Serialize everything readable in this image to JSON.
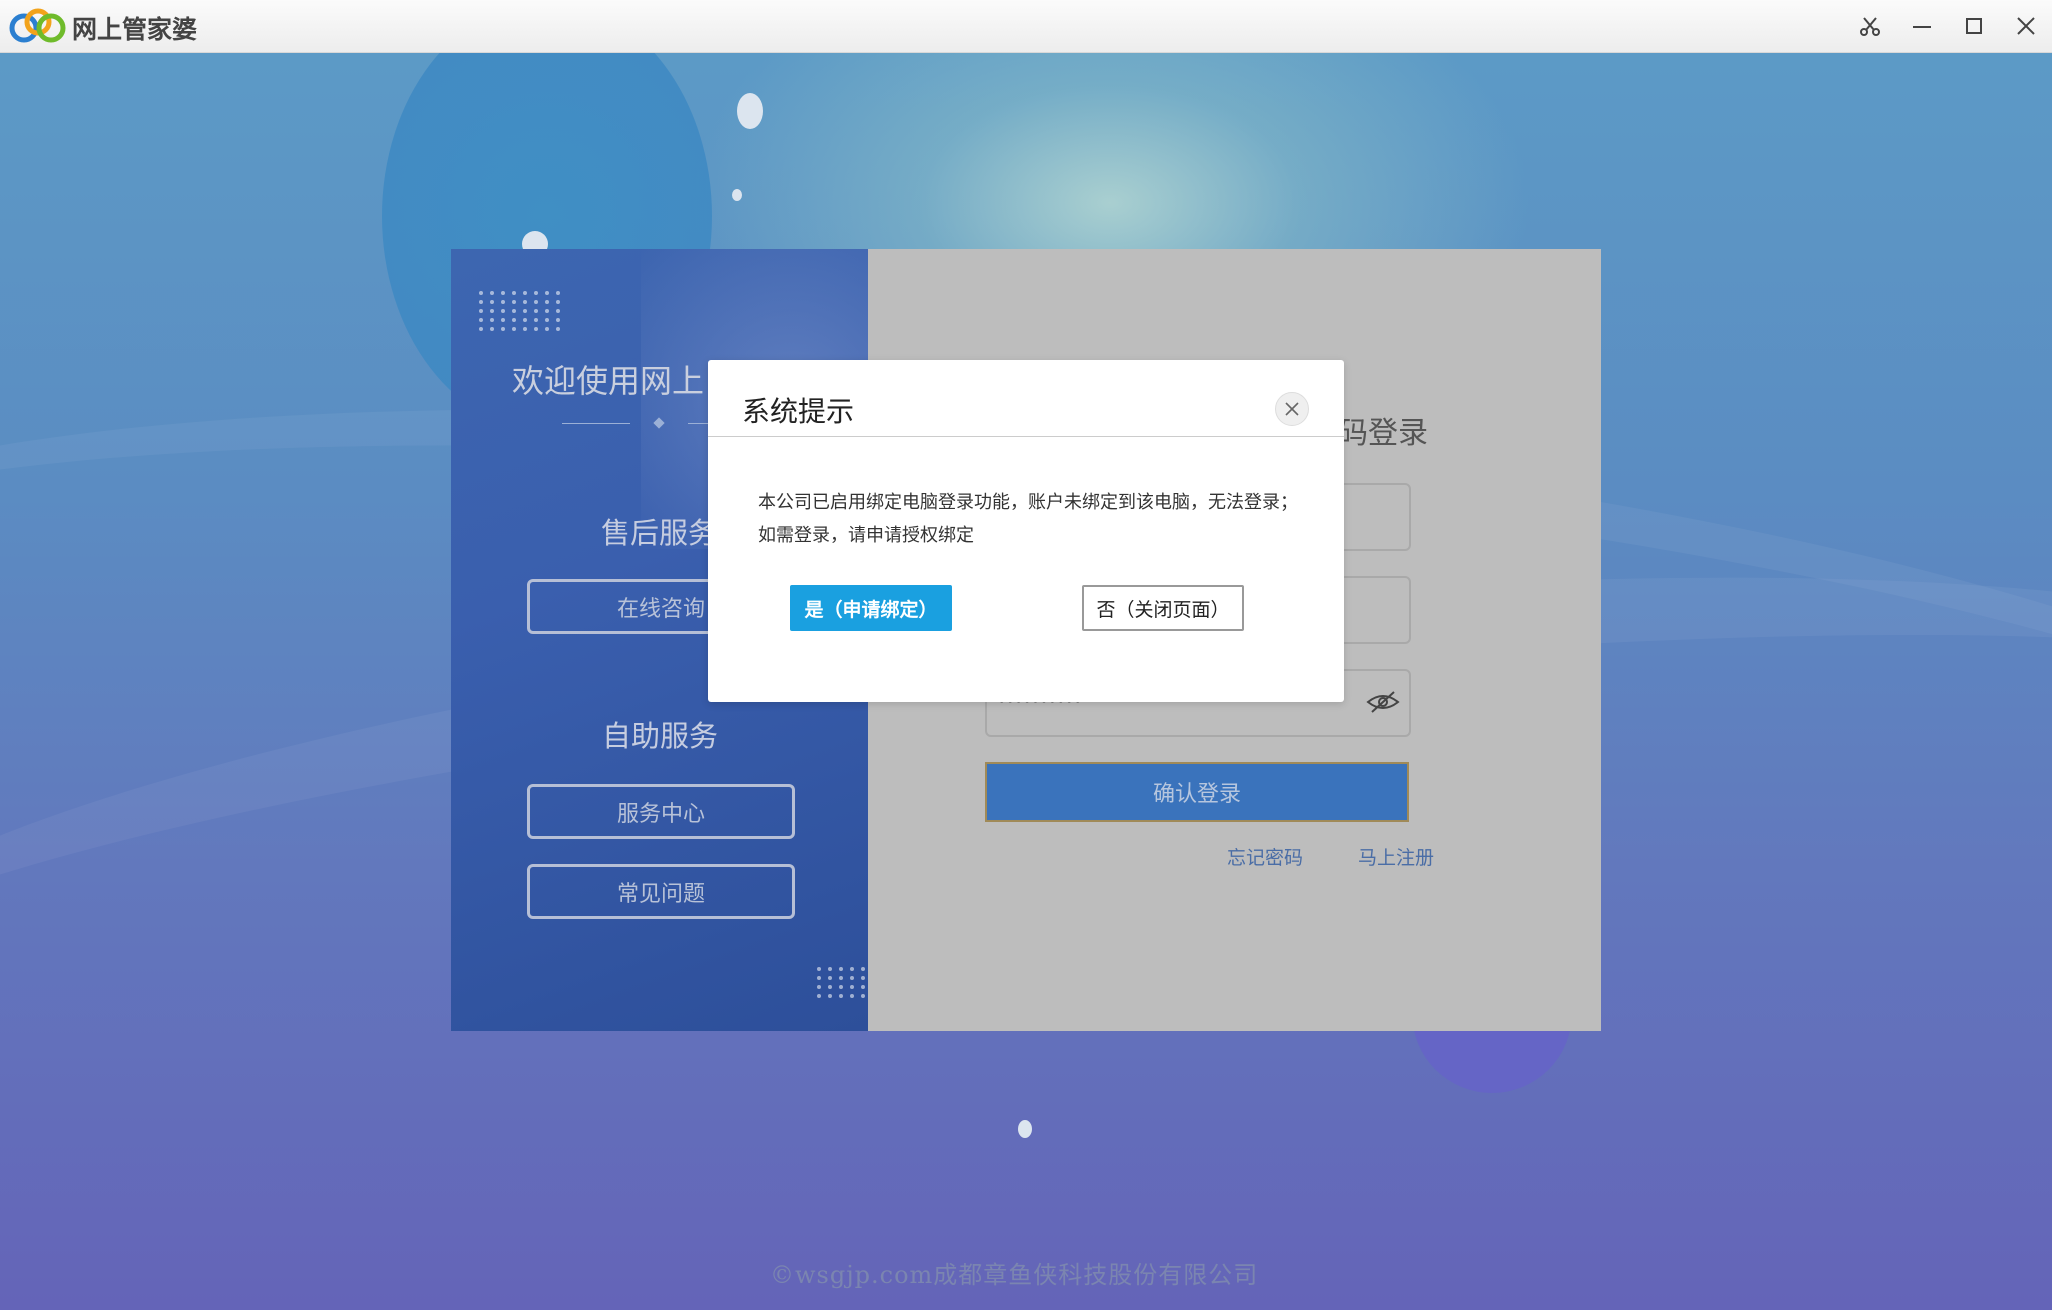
{
  "window": {
    "title": "网上管家婆",
    "controls": [
      "scissors-icon",
      "minimize-icon",
      "maximize-icon",
      "close-icon"
    ]
  },
  "left_panel": {
    "welcome": "欢迎使用网上",
    "after_sales_title": "售后服务",
    "online_consult": "在线咨询",
    "self_service_title": "自助服务",
    "service_center": "服务中心",
    "faq": "常见问题"
  },
  "login": {
    "title_fragment": "码登录",
    "password_masked": "••••••••••",
    "confirm_button": "确认登录",
    "forgot_password": "忘记密码",
    "register": "马上注册"
  },
  "dialog": {
    "title": "系统提示",
    "message": "本公司已启用绑定电脑登录功能，账户未绑定到该电脑，无法登录；如需登录，请申请授权绑定",
    "yes_button": "是（申请绑定）",
    "no_button": "否（关闭页面）"
  },
  "footer": {
    "copyright": "©wsgjp.com成都章鱼侠科技股份有限公司"
  },
  "colors": {
    "primary_button": "#1aa0e0",
    "confirm_button": "#3a73bc",
    "left_panel": "#3a5fae"
  }
}
